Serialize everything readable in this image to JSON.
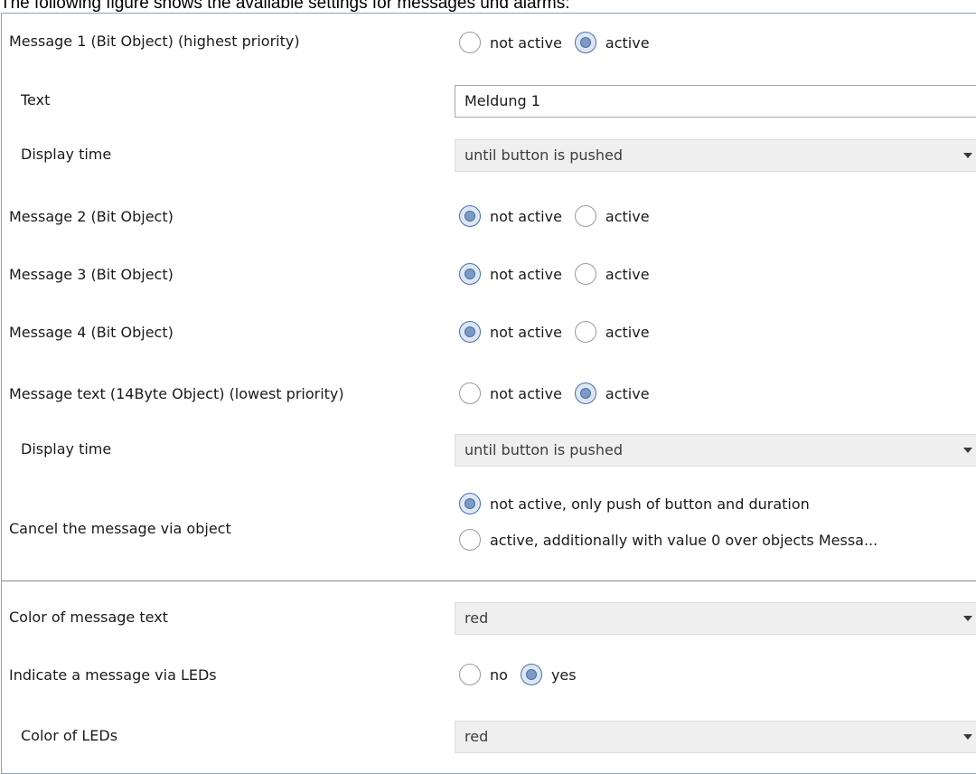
{
  "caption": "The following figure shows the available settings for messages und alarms:",
  "rows": {
    "msg1": {
      "label": "Message 1 (Bit Object) (highest priority)",
      "options": [
        "not active",
        "active"
      ],
      "selected": "active"
    },
    "msg1_text": {
      "label": "Text",
      "value": "Meldung 1"
    },
    "msg1_time": {
      "label": "Display time",
      "value": "until button is pushed"
    },
    "msg2": {
      "label": "Message 2 (Bit Object)",
      "options": [
        "not active",
        "active"
      ],
      "selected": "not active"
    },
    "msg3": {
      "label": "Message 3 (Bit Object)",
      "options": [
        "not active",
        "active"
      ],
      "selected": "not active"
    },
    "msg4": {
      "label": "Message 4 (Bit Object)",
      "options": [
        "not active",
        "active"
      ],
      "selected": "not active"
    },
    "msgtext": {
      "label": "Message text (14Byte Object) (lowest priority)",
      "options": [
        "not active",
        "active"
      ],
      "selected": "active"
    },
    "msgtext_time": {
      "label": "Display time",
      "value": "until button is pushed"
    },
    "cancel": {
      "label": "Cancel the message via object",
      "options": [
        "not active, only push of button and duration",
        "active, additionally with value 0 over objects Messa..."
      ],
      "selected": "not active, only push of button and duration"
    },
    "color_text": {
      "label": "Color of message text",
      "value": "red"
    },
    "leds": {
      "label": "Indicate a message via LEDs",
      "options": [
        "no",
        "yes"
      ],
      "selected": "yes"
    },
    "led_color": {
      "label": "Color of LEDs",
      "value": "red"
    }
  },
  "colors": {
    "panel_border": "#8aa3bd",
    "radio_checked": "#7a9ac8",
    "select_bg": "#efefef"
  },
  "icons": {
    "dropdown": "chevron-down-icon"
  }
}
